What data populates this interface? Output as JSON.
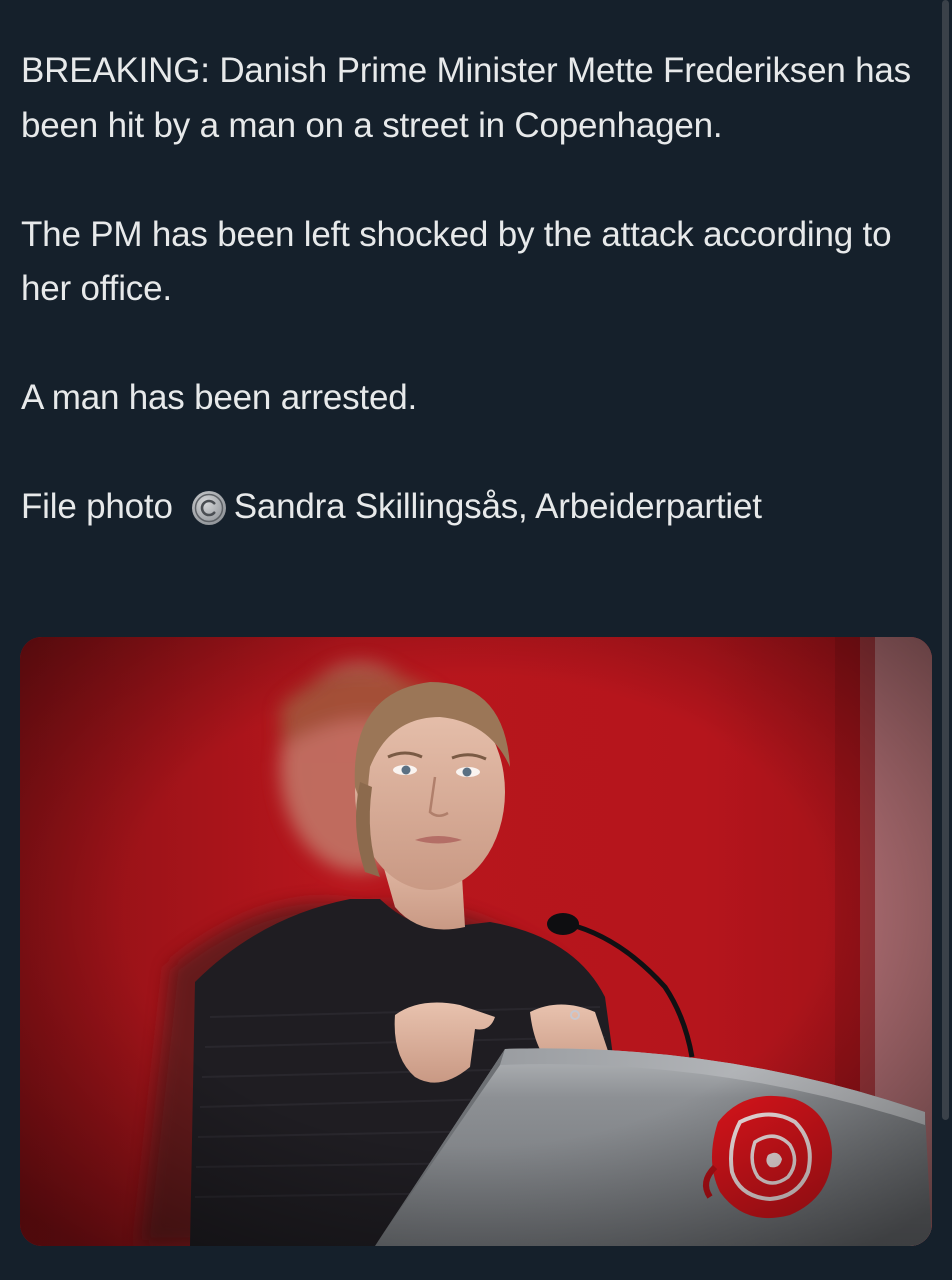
{
  "tweet": {
    "paragraphs": [
      "BREAKING: Danish Prime Minister Mette Frederiksen has been hit by a man on a street in Copenhagen.",
      "The PM has been left shocked by the attack according to her office.",
      "A man has been arrested."
    ],
    "credit_prefix": "File photo",
    "credit_icon": "copyright-icon",
    "credit_name": "Sandra Skillingsås, Arbeiderpartiet"
  },
  "media": {
    "type": "photo",
    "icons": [
      "microphone-icon",
      "rose-logo-icon"
    ]
  },
  "colors": {
    "background": "#15202b",
    "text": "#e7e9ea",
    "stage_red": "#b3151c",
    "podium_gray": "#8c8f93",
    "rose_red": "#d8141b"
  }
}
